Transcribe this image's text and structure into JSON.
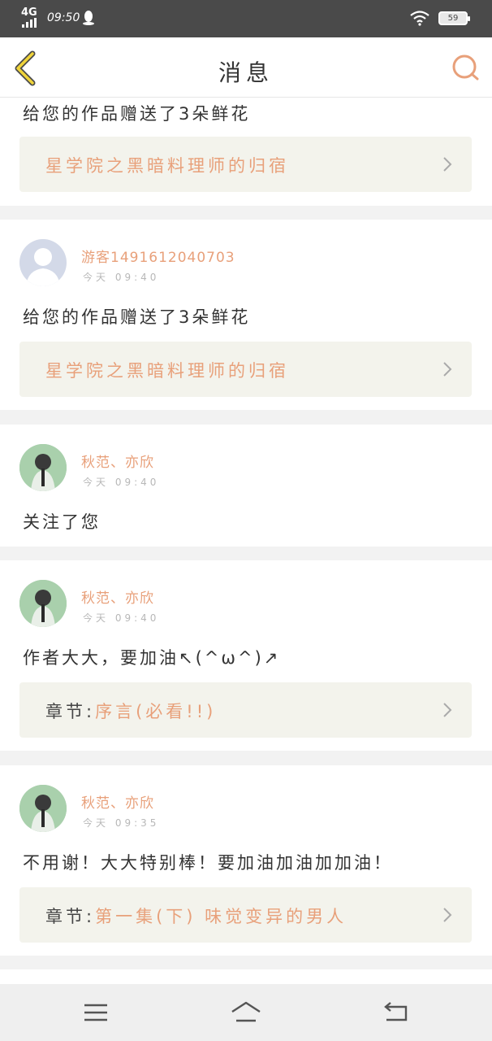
{
  "status_bar": {
    "network": "4G",
    "time": "09:50",
    "battery": "59"
  },
  "header": {
    "title": "消息",
    "back_icon": "back-arrow-icon",
    "search_icon": "search-icon"
  },
  "colors": {
    "accent": "#e8a07a",
    "status_bar_bg": "#4a4a4a",
    "link_box_bg": "#f3f3ec",
    "back_yellow": "#f0d43a"
  },
  "messages": [
    {
      "text": "给您的作品赠送了3朵鲜花",
      "link": {
        "prefix": "",
        "title": "星学院之黑暗料理师的归宿"
      }
    },
    {
      "user": "游客1491612040703",
      "time": "今天 09:40",
      "text": "给您的作品赠送了3朵鲜花",
      "link": {
        "prefix": "",
        "title": "星学院之黑暗料理师的归宿"
      }
    },
    {
      "user": "秋范、亦欣",
      "time": "今天 09:40",
      "text": "关注了您"
    },
    {
      "user": "秋范、亦欣",
      "time": "今天 09:40",
      "text": "作者大大，要加油↖(^ω^)↗",
      "link": {
        "prefix": "章节:",
        "title": "序言(必看!!)"
      }
    },
    {
      "user": "秋范、亦欣",
      "time": "今天 09:35",
      "text": "不用谢！大大特别棒！要加油加油加加油！",
      "link": {
        "prefix": "章节:",
        "title": "第一集(下) 味觉变异的男人"
      }
    }
  ],
  "bottom_nav": {
    "menu_icon": "menu-icon",
    "home_icon": "home-icon",
    "back_icon": "return-icon"
  }
}
